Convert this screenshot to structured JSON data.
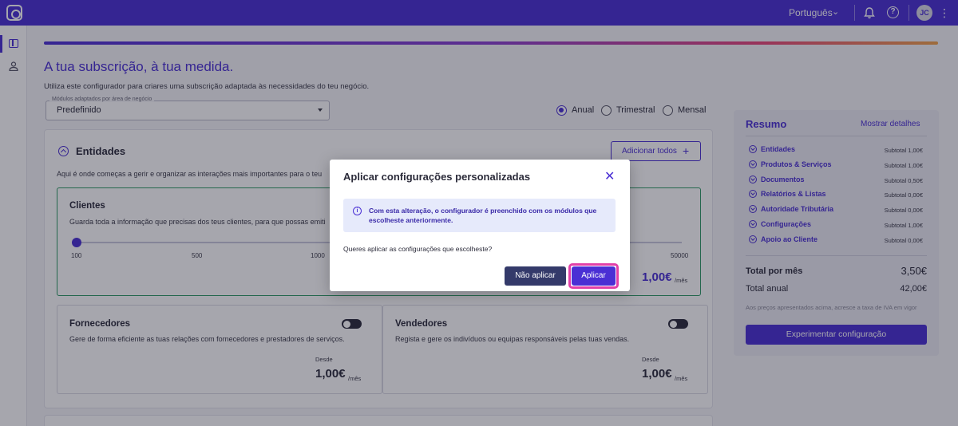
{
  "topbar": {
    "language": "Português",
    "avatar_initials": "JC",
    "icons": [
      "app-logo-icon",
      "chevron-down-icon",
      "bell-icon",
      "help-icon",
      "kebab-menu-icon"
    ]
  },
  "progress": {
    "fraction": 1.0
  },
  "header": {
    "title": "A tua subscrição, à tua medida.",
    "subtitle": "Utiliza este configurador para criares uma subscrição adaptada às necessidades do teu negócio."
  },
  "module_select": {
    "label": "Módulos adaptados por área de negócio",
    "value": "Predefinido"
  },
  "billing": {
    "options": [
      "Anual",
      "Trimestral",
      "Mensal"
    ],
    "selected": "Anual"
  },
  "entities": {
    "title": "Entidades",
    "add_all_label": "Adicionar todos",
    "description": "Aqui é onde começas a gerir e organizar as interações mais importantes para o teu"
  },
  "clients": {
    "title": "Clientes",
    "description": "Guarda toda a informação que precisas dos teus clientes, para que possas emiti",
    "slider_ticks": [
      "100",
      "500",
      "1000",
      "50000"
    ],
    "slider_value": "100",
    "price": "1,00€",
    "price_unit": "/mês"
  },
  "suppliers": {
    "title": "Fornecedores",
    "description": "Gere de forma eficiente as tuas relações com fornecedores e prestadores de serviços.",
    "from_label": "Desde",
    "price": "1,00€",
    "price_unit": "/mês",
    "enabled": false
  },
  "sellers": {
    "title": "Vendedores",
    "description": "Regista e gere os indivíduos ou equipas responsáveis pelas tuas vendas.",
    "from_label": "Desde",
    "price": "1,00€",
    "price_unit": "/mês",
    "enabled": false
  },
  "summary": {
    "title": "Resumo",
    "details_link": "Mostrar detalhes",
    "rows": [
      {
        "label": "Entidades",
        "value": "Subtotal 1,00€"
      },
      {
        "label": "Produtos & Serviços",
        "value": "Subtotal 1,00€"
      },
      {
        "label": "Documentos",
        "value": "Subtotal 0,50€"
      },
      {
        "label": "Relatórios & Listas",
        "value": "Subtotal 0,00€"
      },
      {
        "label": "Autoridade Tributária",
        "value": "Subtotal 0,00€"
      },
      {
        "label": "Configurações",
        "value": "Subtotal 1,00€"
      },
      {
        "label": "Apoio ao Cliente",
        "value": "Subtotal 0,00€"
      }
    ],
    "monthly_label": "Total por mês",
    "monthly_value": "3,50€",
    "annual_label": "Total anual",
    "annual_value": "42,00€",
    "note": "Aos preços apresentados acima, acresce a taxa de IVA em vigor",
    "cta_label": "Experimentar configuração"
  },
  "modal": {
    "title": "Aplicar configurações personalizadas",
    "info_text": "Com esta alteração, o configurador é preenchido com os módulos que escolheste anteriormente.",
    "question": "Queres aplicar as configurações que escolheste?",
    "cancel_label": "Não aplicar",
    "confirm_label": "Aplicar"
  }
}
